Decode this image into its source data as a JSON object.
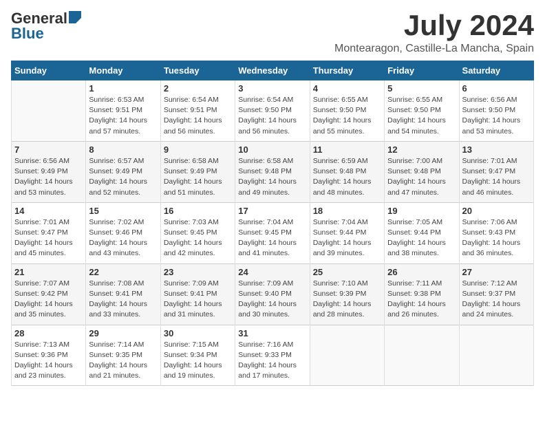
{
  "header": {
    "logo_general": "General",
    "logo_blue": "Blue",
    "month": "July 2024",
    "location": "Montearagon, Castille-La Mancha, Spain"
  },
  "weekdays": [
    "Sunday",
    "Monday",
    "Tuesday",
    "Wednesday",
    "Thursday",
    "Friday",
    "Saturday"
  ],
  "weeks": [
    [
      {
        "day": "",
        "sunrise": "",
        "sunset": "",
        "daylight": ""
      },
      {
        "day": "1",
        "sunrise": "Sunrise: 6:53 AM",
        "sunset": "Sunset: 9:51 PM",
        "daylight": "Daylight: 14 hours and 57 minutes."
      },
      {
        "day": "2",
        "sunrise": "Sunrise: 6:54 AM",
        "sunset": "Sunset: 9:51 PM",
        "daylight": "Daylight: 14 hours and 56 minutes."
      },
      {
        "day": "3",
        "sunrise": "Sunrise: 6:54 AM",
        "sunset": "Sunset: 9:50 PM",
        "daylight": "Daylight: 14 hours and 56 minutes."
      },
      {
        "day": "4",
        "sunrise": "Sunrise: 6:55 AM",
        "sunset": "Sunset: 9:50 PM",
        "daylight": "Daylight: 14 hours and 55 minutes."
      },
      {
        "day": "5",
        "sunrise": "Sunrise: 6:55 AM",
        "sunset": "Sunset: 9:50 PM",
        "daylight": "Daylight: 14 hours and 54 minutes."
      },
      {
        "day": "6",
        "sunrise": "Sunrise: 6:56 AM",
        "sunset": "Sunset: 9:50 PM",
        "daylight": "Daylight: 14 hours and 53 minutes."
      }
    ],
    [
      {
        "day": "7",
        "sunrise": "Sunrise: 6:56 AM",
        "sunset": "Sunset: 9:49 PM",
        "daylight": "Daylight: 14 hours and 53 minutes."
      },
      {
        "day": "8",
        "sunrise": "Sunrise: 6:57 AM",
        "sunset": "Sunset: 9:49 PM",
        "daylight": "Daylight: 14 hours and 52 minutes."
      },
      {
        "day": "9",
        "sunrise": "Sunrise: 6:58 AM",
        "sunset": "Sunset: 9:49 PM",
        "daylight": "Daylight: 14 hours and 51 minutes."
      },
      {
        "day": "10",
        "sunrise": "Sunrise: 6:58 AM",
        "sunset": "Sunset: 9:48 PM",
        "daylight": "Daylight: 14 hours and 49 minutes."
      },
      {
        "day": "11",
        "sunrise": "Sunrise: 6:59 AM",
        "sunset": "Sunset: 9:48 PM",
        "daylight": "Daylight: 14 hours and 48 minutes."
      },
      {
        "day": "12",
        "sunrise": "Sunrise: 7:00 AM",
        "sunset": "Sunset: 9:48 PM",
        "daylight": "Daylight: 14 hours and 47 minutes."
      },
      {
        "day": "13",
        "sunrise": "Sunrise: 7:01 AM",
        "sunset": "Sunset: 9:47 PM",
        "daylight": "Daylight: 14 hours and 46 minutes."
      }
    ],
    [
      {
        "day": "14",
        "sunrise": "Sunrise: 7:01 AM",
        "sunset": "Sunset: 9:47 PM",
        "daylight": "Daylight: 14 hours and 45 minutes."
      },
      {
        "day": "15",
        "sunrise": "Sunrise: 7:02 AM",
        "sunset": "Sunset: 9:46 PM",
        "daylight": "Daylight: 14 hours and 43 minutes."
      },
      {
        "day": "16",
        "sunrise": "Sunrise: 7:03 AM",
        "sunset": "Sunset: 9:45 PM",
        "daylight": "Daylight: 14 hours and 42 minutes."
      },
      {
        "day": "17",
        "sunrise": "Sunrise: 7:04 AM",
        "sunset": "Sunset: 9:45 PM",
        "daylight": "Daylight: 14 hours and 41 minutes."
      },
      {
        "day": "18",
        "sunrise": "Sunrise: 7:04 AM",
        "sunset": "Sunset: 9:44 PM",
        "daylight": "Daylight: 14 hours and 39 minutes."
      },
      {
        "day": "19",
        "sunrise": "Sunrise: 7:05 AM",
        "sunset": "Sunset: 9:44 PM",
        "daylight": "Daylight: 14 hours and 38 minutes."
      },
      {
        "day": "20",
        "sunrise": "Sunrise: 7:06 AM",
        "sunset": "Sunset: 9:43 PM",
        "daylight": "Daylight: 14 hours and 36 minutes."
      }
    ],
    [
      {
        "day": "21",
        "sunrise": "Sunrise: 7:07 AM",
        "sunset": "Sunset: 9:42 PM",
        "daylight": "Daylight: 14 hours and 35 minutes."
      },
      {
        "day": "22",
        "sunrise": "Sunrise: 7:08 AM",
        "sunset": "Sunset: 9:41 PM",
        "daylight": "Daylight: 14 hours and 33 minutes."
      },
      {
        "day": "23",
        "sunrise": "Sunrise: 7:09 AM",
        "sunset": "Sunset: 9:41 PM",
        "daylight": "Daylight: 14 hours and 31 minutes."
      },
      {
        "day": "24",
        "sunrise": "Sunrise: 7:09 AM",
        "sunset": "Sunset: 9:40 PM",
        "daylight": "Daylight: 14 hours and 30 minutes."
      },
      {
        "day": "25",
        "sunrise": "Sunrise: 7:10 AM",
        "sunset": "Sunset: 9:39 PM",
        "daylight": "Daylight: 14 hours and 28 minutes."
      },
      {
        "day": "26",
        "sunrise": "Sunrise: 7:11 AM",
        "sunset": "Sunset: 9:38 PM",
        "daylight": "Daylight: 14 hours and 26 minutes."
      },
      {
        "day": "27",
        "sunrise": "Sunrise: 7:12 AM",
        "sunset": "Sunset: 9:37 PM",
        "daylight": "Daylight: 14 hours and 24 minutes."
      }
    ],
    [
      {
        "day": "28",
        "sunrise": "Sunrise: 7:13 AM",
        "sunset": "Sunset: 9:36 PM",
        "daylight": "Daylight: 14 hours and 23 minutes."
      },
      {
        "day": "29",
        "sunrise": "Sunrise: 7:14 AM",
        "sunset": "Sunset: 9:35 PM",
        "daylight": "Daylight: 14 hours and 21 minutes."
      },
      {
        "day": "30",
        "sunrise": "Sunrise: 7:15 AM",
        "sunset": "Sunset: 9:34 PM",
        "daylight": "Daylight: 14 hours and 19 minutes."
      },
      {
        "day": "31",
        "sunrise": "Sunrise: 7:16 AM",
        "sunset": "Sunset: 9:33 PM",
        "daylight": "Daylight: 14 hours and 17 minutes."
      },
      {
        "day": "",
        "sunrise": "",
        "sunset": "",
        "daylight": ""
      },
      {
        "day": "",
        "sunrise": "",
        "sunset": "",
        "daylight": ""
      },
      {
        "day": "",
        "sunrise": "",
        "sunset": "",
        "daylight": ""
      }
    ]
  ]
}
